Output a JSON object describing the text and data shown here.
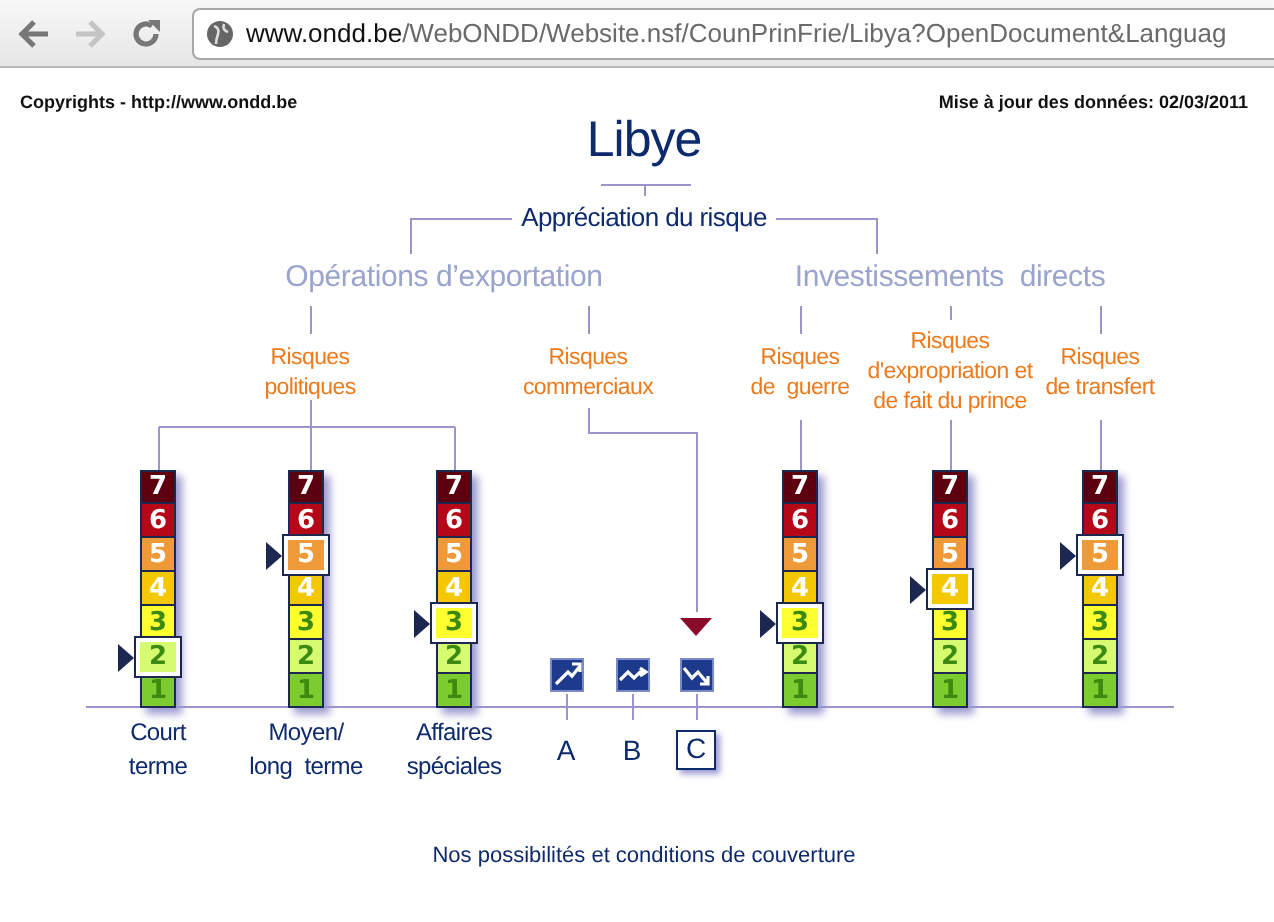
{
  "browser": {
    "url_host": "www.ondd.be",
    "url_path": "/WebONDD/Website.nsf/CounPrinFrie/Libya?OpenDocument&Languag"
  },
  "header": {
    "copyright": "Copyrights - http://www.ondd.be",
    "updated": "Mise à jour des données: 02/03/2011"
  },
  "title": "Libye",
  "root": "Appréciation du risque",
  "export": {
    "label": "Opérations d’exportation",
    "political": {
      "label": "Risques\npolitiques",
      "scales": [
        {
          "caption": "Court\nterme",
          "cells": [
            {
              "label": "7",
              "color": "#5c0010",
              "selected": false
            },
            {
              "label": "6",
              "color": "#b40818",
              "selected": false
            },
            {
              "label": "5",
              "color": "#ee9a38",
              "selected": false
            },
            {
              "label": "4",
              "color": "#f4c800",
              "selected": false
            },
            {
              "label": "3",
              "color": "#ffff30",
              "selected": false
            },
            {
              "label": "2",
              "color": "#d6fa70",
              "selected": true
            },
            {
              "label": "1",
              "color": "#7ccc30",
              "selected": false
            }
          ]
        },
        {
          "caption": "Moyen/\nlong  terme",
          "cells": [
            {
              "label": "7",
              "color": "#5c0010",
              "selected": false
            },
            {
              "label": "6",
              "color": "#b40818",
              "selected": false
            },
            {
              "label": "5",
              "color": "#ee9a38",
              "selected": true
            },
            {
              "label": "4",
              "color": "#f4c800",
              "selected": false
            },
            {
              "label": "3",
              "color": "#ffff30",
              "selected": false
            },
            {
              "label": "2",
              "color": "#d6fa70",
              "selected": false
            },
            {
              "label": "1",
              "color": "#7ccc30",
              "selected": false
            }
          ]
        },
        {
          "caption": "Affaires\nspéciales",
          "cells": [
            {
              "label": "7",
              "color": "#5c0010",
              "selected": false
            },
            {
              "label": "6",
              "color": "#b40818",
              "selected": false
            },
            {
              "label": "5",
              "color": "#ee9a38",
              "selected": false
            },
            {
              "label": "4",
              "color": "#f4c800",
              "selected": false
            },
            {
              "label": "3",
              "color": "#ffff30",
              "selected": true
            },
            {
              "label": "2",
              "color": "#d6fa70",
              "selected": false
            },
            {
              "label": "1",
              "color": "#7ccc30",
              "selected": false
            }
          ]
        }
      ]
    },
    "commercial": {
      "label": "Risques\ncommerciaux",
      "classes": [
        {
          "label": "A",
          "selected": false
        },
        {
          "label": "B",
          "selected": false
        },
        {
          "label": "C",
          "selected": true
        }
      ]
    }
  },
  "investment": {
    "label": "Investissements  directs",
    "categories": [
      {
        "label": "Risques\nde  guerre",
        "cells": [
          {
            "label": "7",
            "color": "#5c0010",
            "selected": false
          },
          {
            "label": "6",
            "color": "#b40818",
            "selected": false
          },
          {
            "label": "5",
            "color": "#ee9a38",
            "selected": false
          },
          {
            "label": "4",
            "color": "#f4c800",
            "selected": false
          },
          {
            "label": "3",
            "color": "#ffff30",
            "selected": true
          },
          {
            "label": "2",
            "color": "#d6fa70",
            "selected": false
          },
          {
            "label": "1",
            "color": "#7ccc30",
            "selected": false
          }
        ]
      },
      {
        "label": "Risques\nd'expropriation et\nde fait du prince",
        "cells": [
          {
            "label": "7",
            "color": "#5c0010",
            "selected": false
          },
          {
            "label": "6",
            "color": "#b40818",
            "selected": false
          },
          {
            "label": "5",
            "color": "#ee9a38",
            "selected": false
          },
          {
            "label": "4",
            "color": "#f4c800",
            "selected": true
          },
          {
            "label": "3",
            "color": "#ffff30",
            "selected": false
          },
          {
            "label": "2",
            "color": "#d6fa70",
            "selected": false
          },
          {
            "label": "1",
            "color": "#7ccc30",
            "selected": false
          }
        ]
      },
      {
        "label": "Risques\nde transfert",
        "cells": [
          {
            "label": "7",
            "color": "#5c0010",
            "selected": false
          },
          {
            "label": "6",
            "color": "#b40818",
            "selected": false
          },
          {
            "label": "5",
            "color": "#ee9a38",
            "selected": true
          },
          {
            "label": "4",
            "color": "#f4c800",
            "selected": false
          },
          {
            "label": "3",
            "color": "#ffff30",
            "selected": false
          },
          {
            "label": "2",
            "color": "#d6fa70",
            "selected": false
          },
          {
            "label": "1",
            "color": "#7ccc30",
            "selected": false
          }
        ]
      }
    ]
  },
  "link": "Nos possibilités et conditions de couverture"
}
